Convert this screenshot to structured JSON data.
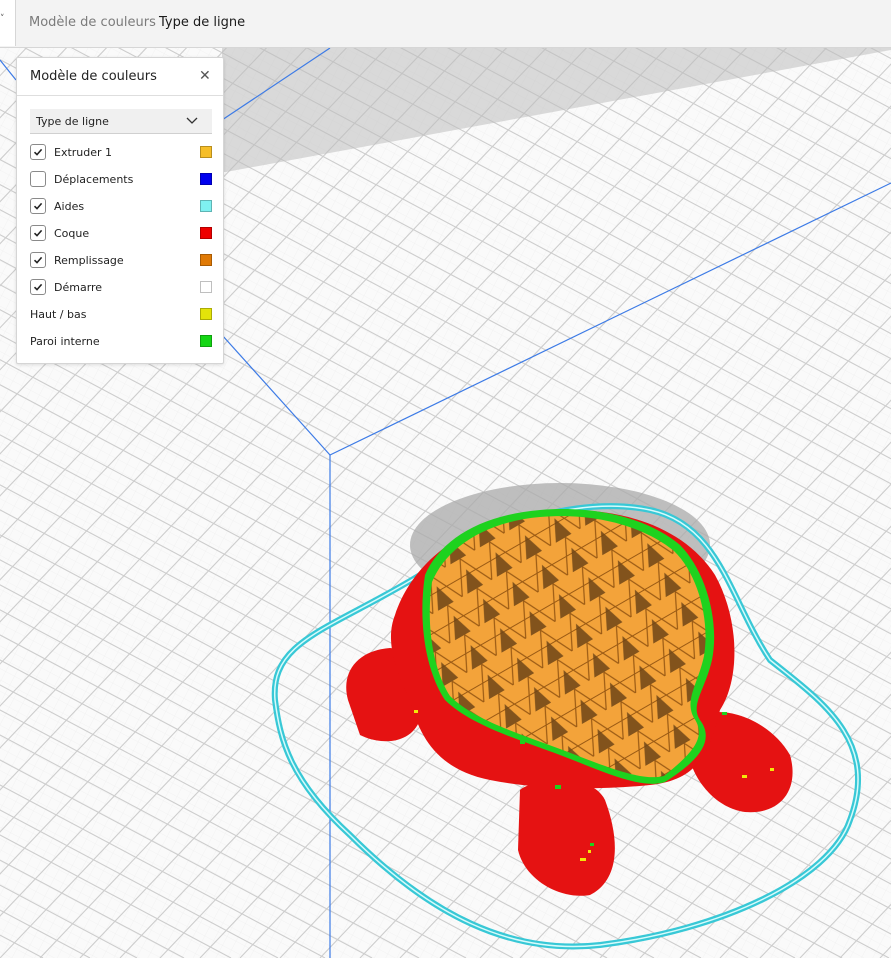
{
  "breadcrumbs": [
    "Modèle de couleurs",
    "Type de ligne"
  ],
  "panel": {
    "title": "Modèle de couleurs",
    "dropdown": {
      "selected": "Type de ligne"
    },
    "items": [
      {
        "label": "Extruder 1",
        "checked": true,
        "color": "#f6be28"
      },
      {
        "label": "Déplacements",
        "checked": false,
        "color": "#0000ee"
      },
      {
        "label": "Aides",
        "checked": true,
        "color": "#7ff0f0"
      },
      {
        "label": "Coque",
        "checked": true,
        "color": "#ee0000"
      },
      {
        "label": "Remplissage",
        "checked": true,
        "color": "#e07a06"
      },
      {
        "label": "Démarre",
        "checked": true,
        "color": "#ffffff"
      },
      {
        "label": "Haut / bas",
        "color": "#e4e40a"
      },
      {
        "label": "Paroi interne",
        "color": "#14d614"
      }
    ]
  }
}
